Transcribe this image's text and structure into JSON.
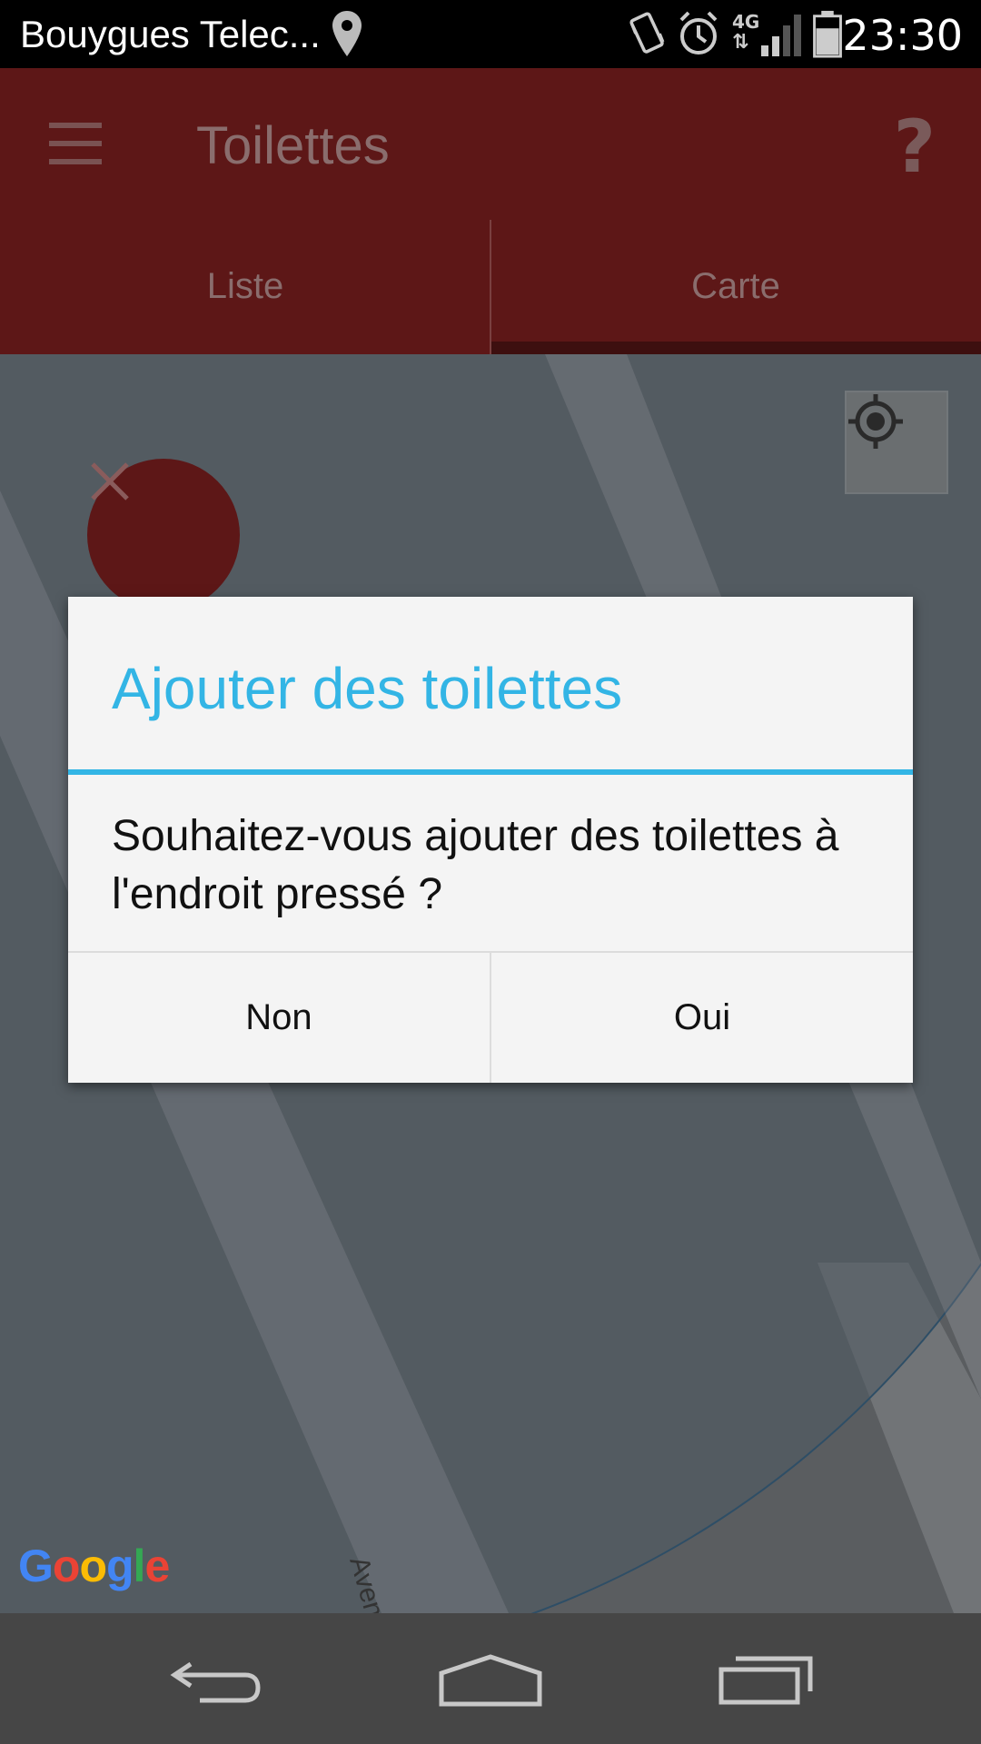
{
  "status_bar": {
    "carrier": "Bouygues Telec...",
    "network": "4G",
    "time": "23:30",
    "icons": [
      "location-pin-icon",
      "vibrate-icon",
      "alarm-icon",
      "network-4g-icon",
      "signal-icon",
      "battery-icon"
    ]
  },
  "app_bar": {
    "title": "Toilettes",
    "help_label": "?"
  },
  "tabs": [
    {
      "label": "Liste",
      "active": false
    },
    {
      "label": "Carte",
      "active": true
    }
  ],
  "map": {
    "attribution": "Google",
    "street_label": "Avenue"
  },
  "dialog": {
    "title": "Ajouter des toilettes",
    "message": "Souhaitez-vous ajouter des toilettes à l'endroit pressé ?",
    "negative_label": "Non",
    "positive_label": "Oui"
  },
  "colors": {
    "accent": "#33b5e5",
    "app_bar": "#5d1717",
    "map_overlay": "#5f5f60"
  }
}
